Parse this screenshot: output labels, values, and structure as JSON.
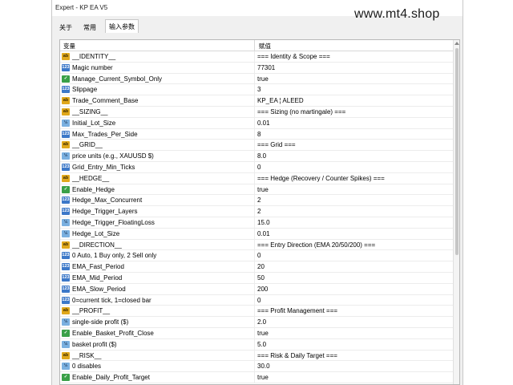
{
  "window": {
    "title": "Expert - KP EA V5"
  },
  "watermark": "www.mt4.shop",
  "tabs": [
    {
      "label": "关于"
    },
    {
      "label": "常用"
    },
    {
      "label": "输入参数"
    }
  ],
  "table": {
    "headers": {
      "variable": "变量",
      "value": "赋值"
    },
    "rows": [
      {
        "icon": "ab",
        "name": "__IDENTITY__",
        "value": "=== Identity & Scope ==="
      },
      {
        "icon": "num",
        "name": "Magic number",
        "value": "77301"
      },
      {
        "icon": "bool",
        "name": "Manage_Current_Symbol_Only",
        "value": "true"
      },
      {
        "icon": "num",
        "name": "Slippage",
        "value": "3"
      },
      {
        "icon": "ab",
        "name": "Trade_Comment_Base",
        "value": "KP_EA ¦ ALEED"
      },
      {
        "icon": "ab",
        "name": "__SIZING__",
        "value": "=== Sizing (no martingale) ==="
      },
      {
        "icon": "dbl",
        "name": "Initial_Lot_Size",
        "value": "0.01"
      },
      {
        "icon": "num",
        "name": "Max_Trades_Per_Side",
        "value": "8"
      },
      {
        "icon": "ab",
        "name": "__GRID__",
        "value": "=== Grid ==="
      },
      {
        "icon": "dbl",
        "name": "price units (e.g., XAUUSD $)",
        "value": "8.0"
      },
      {
        "icon": "num",
        "name": "Grid_Entry_Min_Ticks",
        "value": "0"
      },
      {
        "icon": "ab",
        "name": "__HEDGE__",
        "value": "=== Hedge (Recovery / Counter Spikes) ==="
      },
      {
        "icon": "bool",
        "name": "Enable_Hedge",
        "value": "true"
      },
      {
        "icon": "num",
        "name": "Hedge_Max_Concurrent",
        "value": "2"
      },
      {
        "icon": "num",
        "name": "Hedge_Trigger_Layers",
        "value": "2"
      },
      {
        "icon": "dbl",
        "name": "Hedge_Trigger_FloatingLoss",
        "value": "15.0"
      },
      {
        "icon": "dbl",
        "name": "Hedge_Lot_Size",
        "value": "0.01"
      },
      {
        "icon": "ab",
        "name": "__DIRECTION__",
        "value": "=== Entry Direction (EMA 20/50/200) ==="
      },
      {
        "icon": "num",
        "name": "0 Auto, 1 Buy only, 2 Sell only",
        "value": "0"
      },
      {
        "icon": "num",
        "name": "EMA_Fast_Period",
        "value": "20"
      },
      {
        "icon": "num",
        "name": "EMA_Mid_Period",
        "value": "50"
      },
      {
        "icon": "num",
        "name": "EMA_Slow_Period",
        "value": "200"
      },
      {
        "icon": "num",
        "name": "0=current tick, 1=closed bar",
        "value": "0"
      },
      {
        "icon": "ab",
        "name": "__PROFIT__",
        "value": "=== Profit Management ==="
      },
      {
        "icon": "dbl",
        "name": "single-side profit ($)",
        "value": "2.0"
      },
      {
        "icon": "bool",
        "name": "Enable_Basket_Profit_Close",
        "value": "true"
      },
      {
        "icon": "dbl",
        "name": "basket profit ($)",
        "value": "5.0"
      },
      {
        "icon": "ab",
        "name": "__RISK__",
        "value": "=== Risk & Daily Target ==="
      },
      {
        "icon": "dbl",
        "name": "0 disables",
        "value": "30.0"
      },
      {
        "icon": "bool",
        "name": "Enable_Daily_Profit_Target",
        "value": "true"
      }
    ]
  }
}
